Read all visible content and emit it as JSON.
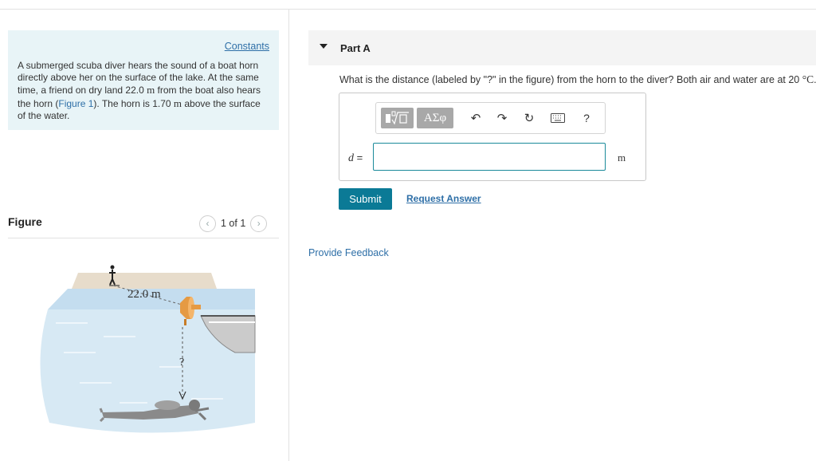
{
  "problem": {
    "constants_label": "Constants",
    "text_before": "A submerged scuba diver hears the sound of a boat horn directly above her on the surface of the lake. At the same time, a friend on dry land 22.0 ",
    "unit_m_1": "m",
    "text_mid": " from the boat also hears the horn (",
    "figure_link": "Figure 1",
    "text_mid2": "). The horn is 1.70 ",
    "unit_m_2": "m",
    "text_end": " above the surface of the water."
  },
  "figure": {
    "title": "Figure",
    "pager_text": "1 of 1",
    "prev_icon": "chevron-left-icon",
    "next_icon": "chevron-right-icon",
    "distance_label": "22.0 m",
    "unknown_label": "?"
  },
  "part": {
    "title": "Part A",
    "question_before": "What is the distance (labeled by \"?\" in the figure) from the horn to the diver? Both air and water are at 20 ",
    "question_unit": "°C",
    "question_after": "."
  },
  "answer": {
    "variable": "d",
    "equals": " =",
    "unit": "m",
    "value": "",
    "toolbar": {
      "templates_icon": "templates-icon",
      "greek_label": "ΑΣφ",
      "undo_icon": "undo-icon",
      "redo_icon": "redo-icon",
      "reset_icon": "reset-icon",
      "keyboard_icon": "keyboard-icon",
      "help_label": "?"
    }
  },
  "actions": {
    "submit_label": "Submit",
    "request_label": "Request Answer",
    "feedback_label": "Provide Feedback"
  },
  "colors": {
    "accent": "#0b7a96",
    "link": "#2e6fa7",
    "panel_bg": "#e8f4f7",
    "water": "#d2e6f3"
  }
}
